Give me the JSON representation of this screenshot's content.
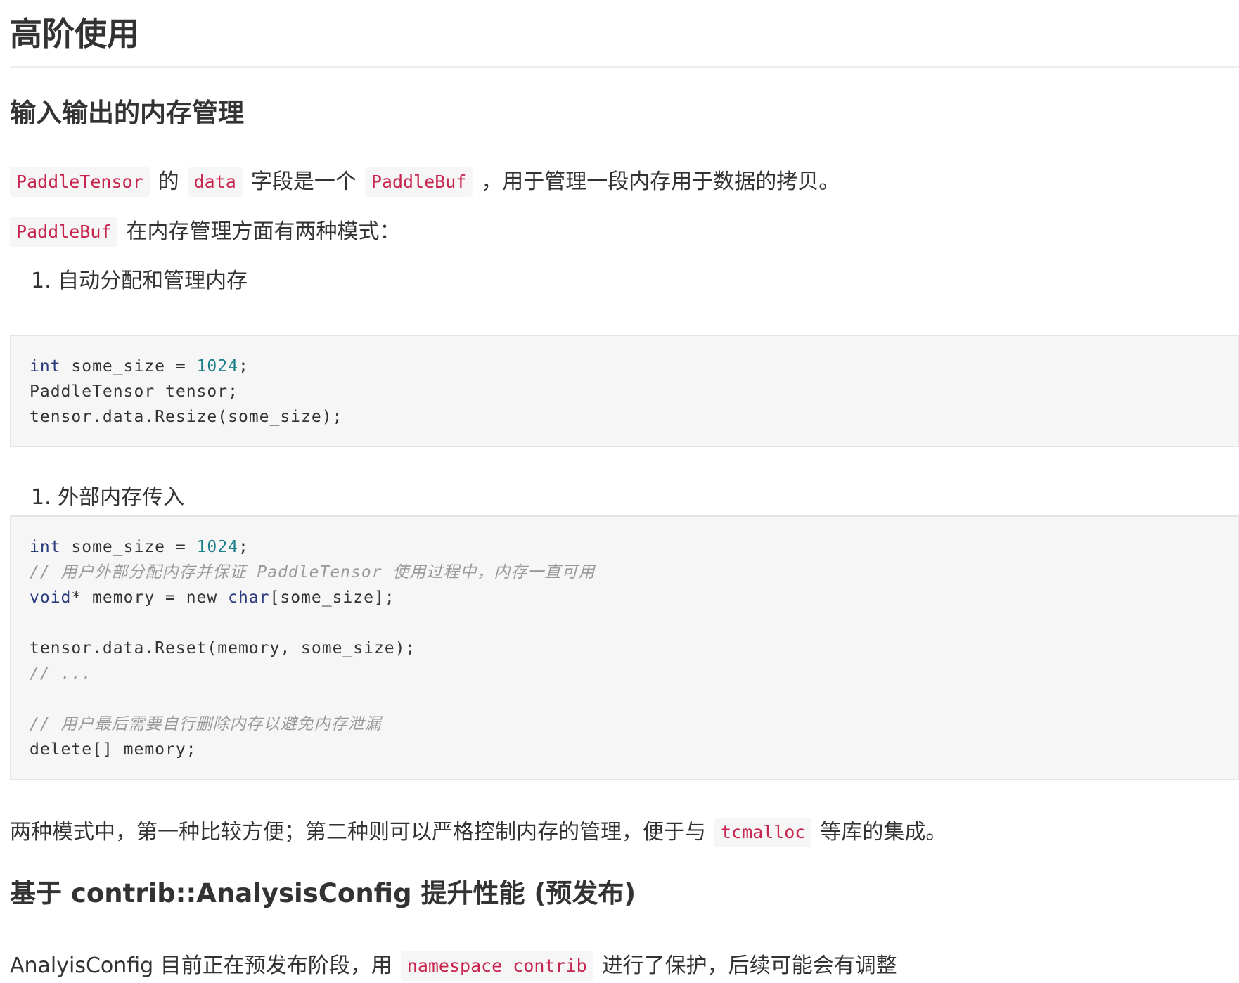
{
  "headings": {
    "h1": "高阶使用",
    "h2_memory": "输入输出的内存管理",
    "h2_contrib": "基于 contrib::AnalysisConfig 提升性能 (预发布)"
  },
  "para1": {
    "code1": "PaddleTensor",
    "text1": "的",
    "code2": "data",
    "text2": "字段是一个",
    "code3": "PaddleBuf",
    "text3": "，用于管理一段内存用于数据的拷贝。"
  },
  "para2": {
    "code1": "PaddleBuf",
    "text1": "在内存管理方面有两种模式："
  },
  "list": {
    "item1": "1. 自动分配和管理内存",
    "item2": "1. 外部内存传入"
  },
  "code_block_1": {
    "line1_kw": "int",
    "line1_mid": " some_size = ",
    "line1_num": "1024",
    "line1_end": ";",
    "line2": "PaddleTensor tensor;",
    "line3": "tensor.data.Resize(some_size);"
  },
  "code_block_2": {
    "line1_kw": "int",
    "line1_mid": " some_size = ",
    "line1_num": "1024",
    "line1_end": ";",
    "line2_comment": "// 用户外部分配内存并保证 PaddleTensor 使用过程中，内存一直可用",
    "line3_kw": "void",
    "line3_mid": "* memory = new ",
    "line3_kw2": "char",
    "line3_end": "[some_size];",
    "line4": "tensor.data.Reset(memory, some_size);",
    "line5_comment": "// ...",
    "line6_comment": "// 用户最后需要自行删除内存以避免内存泄漏",
    "line7": "delete[] memory;"
  },
  "para3": {
    "text1": "两种模式中，第一种比较方便；第二种则可以严格控制内存的管理，便于与",
    "code1": "tcmalloc",
    "text2": "等库的集成。"
  },
  "para4": {
    "text1": "AnalyisConfig 目前正在预发布阶段，用",
    "code1": "namespace contrib",
    "text2": "进行了保护，后续可能会有调整"
  }
}
